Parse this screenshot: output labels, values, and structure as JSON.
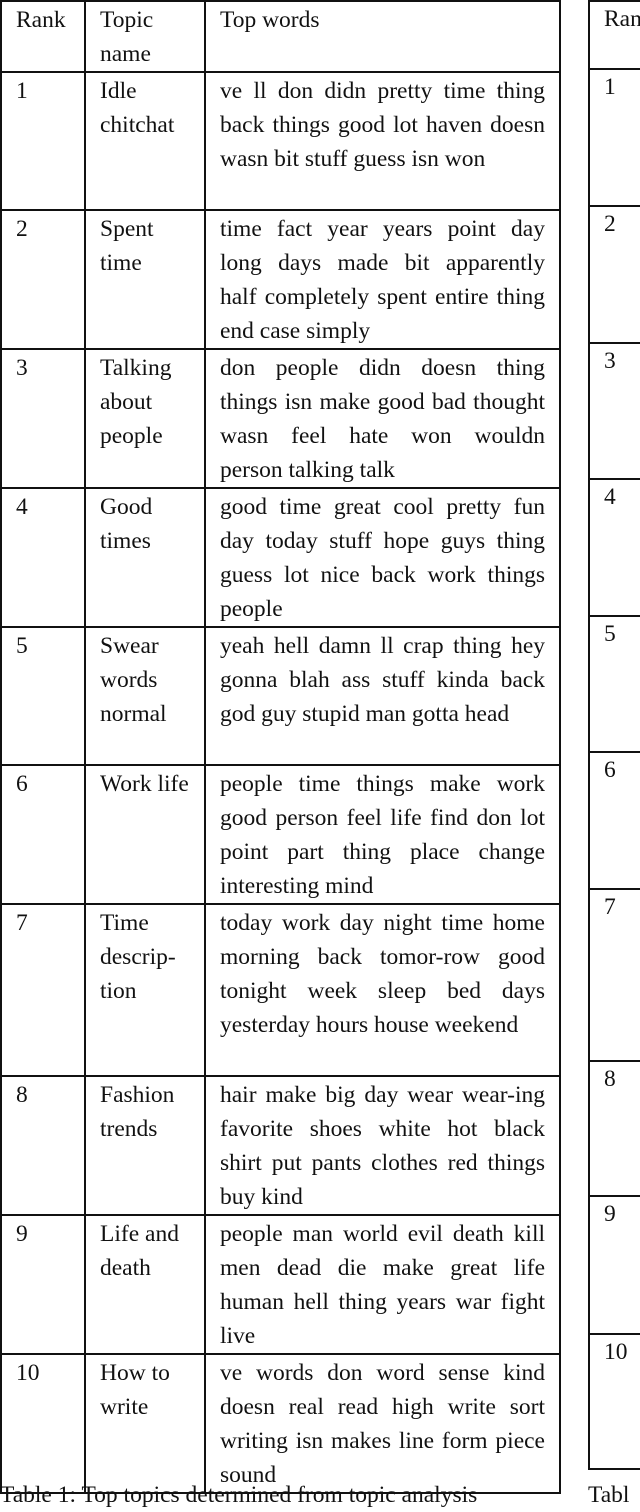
{
  "table": {
    "headers": {
      "rank": "Rank",
      "topic_name": "Topic name",
      "top_words": "Top words"
    },
    "rows": [
      {
        "rank": "1",
        "topic_name": "Idle chitchat",
        "top_words": "ve ll don didn pretty time thing back things good lot haven doesn wasn bit stuff guess isn won"
      },
      {
        "rank": "2",
        "topic_name": "Spent time",
        "top_words": "time fact year years point day long days made bit apparently half completely spent entire thing end case simply"
      },
      {
        "rank": "3",
        "topic_name": "Talking about people",
        "top_words": "don people didn doesn thing things isn make good bad thought wasn feel hate won wouldn person talking talk"
      },
      {
        "rank": "4",
        "topic_name": "Good times",
        "top_words": "good time great cool pretty fun day today stuff hope guys thing guess lot nice back work things people"
      },
      {
        "rank": "5",
        "topic_name": "Swear words normal",
        "top_words": "yeah hell damn ll crap thing hey gonna blah ass stuff kinda back god guy stupid man gotta head"
      },
      {
        "rank": "6",
        "topic_name": "Work life",
        "top_words": "people time things make work good person feel life find don lot point part thing place change interesting mind"
      },
      {
        "rank": "7",
        "topic_name": "Time descrip-tion",
        "top_words": "today work day night time home morning back tomor-row good tonight week sleep bed days yesterday hours house weekend"
      },
      {
        "rank": "8",
        "topic_name": "Fashion trends",
        "top_words": "hair make big day wear wear-ing favorite shoes white hot black shirt put pants clothes red things buy kind"
      },
      {
        "rank": "9",
        "topic_name": "Life and death",
        "top_words": "people man world evil death kill men dead die make great life human hell thing years war fight live"
      },
      {
        "rank": "10",
        "topic_name": "How to write",
        "top_words": "ve words don word sense kind doesn real read high write sort writing isn makes line form piece sound"
      }
    ]
  },
  "right_table": {
    "header_fragment": "Ran",
    "ranks": [
      "1",
      "2",
      "3",
      "4",
      "5",
      "6",
      "7",
      "8",
      "9",
      "10"
    ]
  },
  "captions": {
    "left": "Table 1: Top topics determined from topic analysis",
    "right": "Tabl"
  }
}
